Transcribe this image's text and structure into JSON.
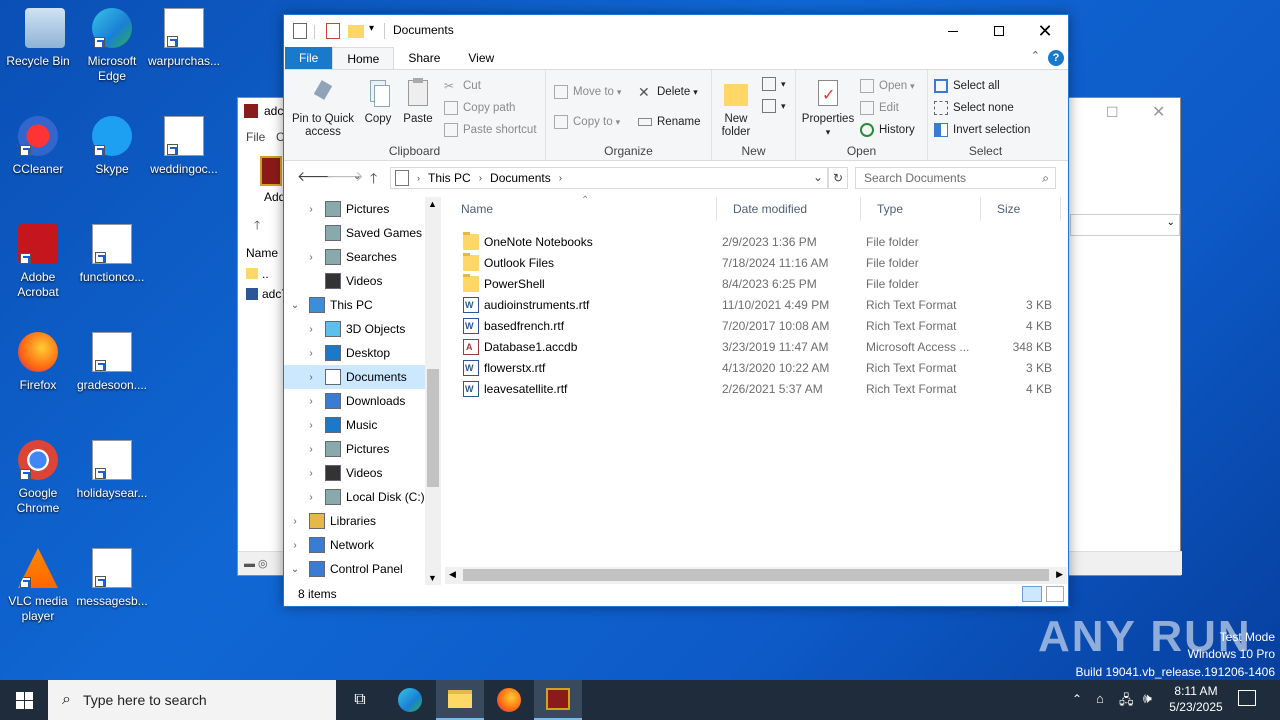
{
  "desktop": {
    "icons": [
      {
        "label": "Recycle Bin"
      },
      {
        "label": "Microsoft Edge"
      },
      {
        "label": "warpurchas..."
      },
      {
        "label": "CCleaner"
      },
      {
        "label": "Skype"
      },
      {
        "label": "weddingoc..."
      },
      {
        "label": "Adobe Acrobat"
      },
      {
        "label": "functionco..."
      },
      {
        "label": "Firefox"
      },
      {
        "label": "gradesoon...."
      },
      {
        "label": "Google Chrome"
      },
      {
        "label": "holidaysear..."
      },
      {
        "label": "VLC media player"
      },
      {
        "label": "messagesb..."
      }
    ]
  },
  "bg_window": {
    "title_fragment": "adc",
    "tab_file": "File",
    "tab_c": "C",
    "col_name": "Name",
    "row1": "..",
    "row2": "adc7",
    "toolbar_fragment": "Add"
  },
  "explorer": {
    "title": "Documents",
    "tabs": {
      "file": "File",
      "home": "Home",
      "share": "Share",
      "view": "View"
    },
    "ribbon": {
      "clipboard": {
        "label": "Clipboard",
        "pin": "Pin to Quick access",
        "copy": "Copy",
        "paste": "Paste",
        "cut": "Cut",
        "copy_path": "Copy path",
        "paste_shortcut": "Paste shortcut"
      },
      "organize": {
        "label": "Organize",
        "move_to": "Move to",
        "copy_to": "Copy to",
        "delete": "Delete",
        "rename": "Rename"
      },
      "new": {
        "label": "New",
        "new_folder": "New folder"
      },
      "open": {
        "label": "Open",
        "properties": "Properties",
        "open": "Open",
        "edit": "Edit",
        "history": "History"
      },
      "select": {
        "label": "Select",
        "select_all": "Select all",
        "select_none": "Select none",
        "invert": "Invert selection"
      }
    },
    "address": {
      "this_pc": "This PC",
      "documents": "Documents"
    },
    "search_placeholder": "Search Documents",
    "nav": [
      {
        "label": "Pictures",
        "chev": true
      },
      {
        "label": "Saved Games",
        "chev": false
      },
      {
        "label": "Searches",
        "chev": true
      },
      {
        "label": "Videos",
        "chev": false
      },
      {
        "label": "This PC",
        "chev": "open"
      },
      {
        "label": "3D Objects",
        "chev": true
      },
      {
        "label": "Desktop",
        "chev": true
      },
      {
        "label": "Documents",
        "chev": true,
        "selected": true
      },
      {
        "label": "Downloads",
        "chev": true
      },
      {
        "label": "Music",
        "chev": true
      },
      {
        "label": "Pictures",
        "chev": true
      },
      {
        "label": "Videos",
        "chev": true
      },
      {
        "label": "Local Disk (C:)",
        "chev": true
      },
      {
        "label": "Libraries",
        "chev": true
      },
      {
        "label": "Network",
        "chev": true
      },
      {
        "label": "Control Panel",
        "chev": "open"
      }
    ],
    "columns": {
      "name": "Name",
      "date": "Date modified",
      "type": "Type",
      "size": "Size"
    },
    "files": [
      {
        "name": "OneNote Notebooks",
        "date": "2/9/2023 1:36 PM",
        "type": "File folder",
        "size": "",
        "icon": "folder"
      },
      {
        "name": "Outlook Files",
        "date": "7/18/2024 11:16 AM",
        "type": "File folder",
        "size": "",
        "icon": "folder"
      },
      {
        "name": "PowerShell",
        "date": "8/4/2023 6:25 PM",
        "type": "File folder",
        "size": "",
        "icon": "folder"
      },
      {
        "name": "audioinstruments.rtf",
        "date": "11/10/2021 4:49 PM",
        "type": "Rich Text Format",
        "size": "3 KB",
        "icon": "rtf"
      },
      {
        "name": "basedfrench.rtf",
        "date": "7/20/2017 10:08 AM",
        "type": "Rich Text Format",
        "size": "4 KB",
        "icon": "rtf"
      },
      {
        "name": "Database1.accdb",
        "date": "3/23/2019 11:47 AM",
        "type": "Microsoft Access ...",
        "size": "348 KB",
        "icon": "acc"
      },
      {
        "name": "flowerstx.rtf",
        "date": "4/13/2020 10:22 AM",
        "type": "Rich Text Format",
        "size": "3 KB",
        "icon": "rtf"
      },
      {
        "name": "leavesatellite.rtf",
        "date": "2/26/2021 5:37 AM",
        "type": "Rich Text Format",
        "size": "4 KB",
        "icon": "rtf"
      }
    ],
    "status": "8 items"
  },
  "taskbar": {
    "search_placeholder": "Type here to search",
    "time": "8:11 AM",
    "date": "5/23/2025"
  },
  "watermark": {
    "brand": "ANY RUN",
    "line1": "Test Mode",
    "line2": "Windows 10 Pro",
    "line3": "Build 19041.vb_release.191206-1406"
  }
}
